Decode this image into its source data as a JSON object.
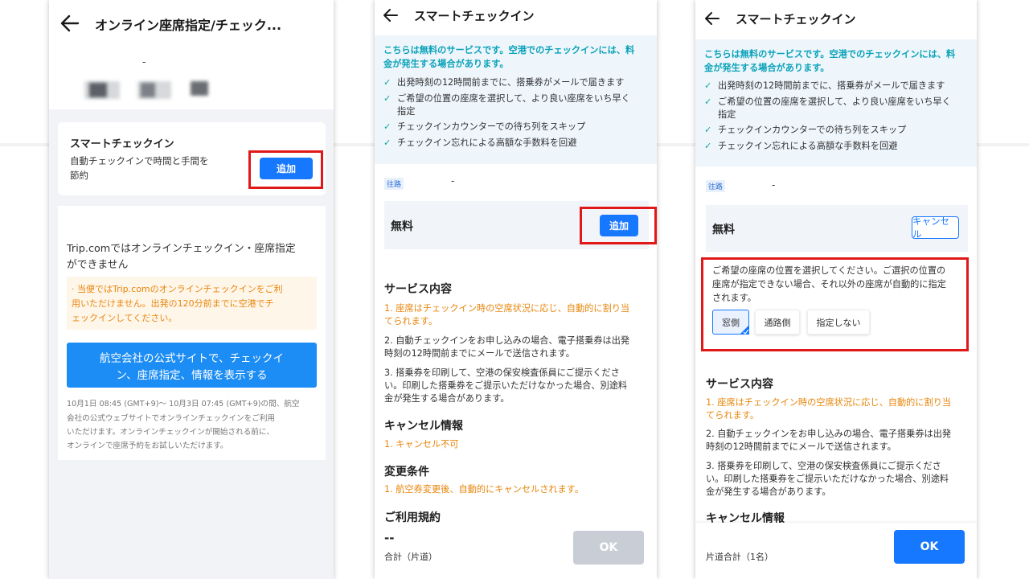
{
  "p1": {
    "title": "オンライン座席指定/チェック...",
    "dash": "-",
    "smart": {
      "title": "スマートチェックイン",
      "desc_line1": "自動チェックインで時間と手間を",
      "desc_line2": "節約",
      "add": "追加"
    },
    "notice_line1": "Trip.comではオンラインチェックイン・座席指定",
    "notice_line2": "ができません",
    "warn_line1": "· 当便ではTrip.comのオンラインチェックインをご利",
    "warn_line2": "用いただけません。出発の120分前までに空港でチ",
    "warn_line3": "ェックインしてください。",
    "airline_btn_line1": "航空会社の公式サイトで、チェックイ",
    "airline_btn_line2": "ン、座席指定、情報を表示する",
    "foot_line1": "10月1日 08:45 (GMT+9)〜 10月3日 07:45 (GMT+9)の間、航空",
    "foot_line2": "会社の公式ウェブサイトでオンラインチェックインをご利用",
    "foot_line3": "いただけます。オンラインチェックインが開始される前に、",
    "foot_line4": "オンラインで座席予約をお試しいただけます。"
  },
  "p2": {
    "title": "スマートチェックイン",
    "note_line1": "こちらは無料のサービスです。空港でのチェックインには、料",
    "note_line2": "金が発生する場合があります。",
    "checks": [
      "出発時刻の12時間前までに、搭乗券がメールで届きます",
      "ご希望の位置の座席を選択して、より良い座席をいち早く",
      "指定",
      "チェックインカウンターでの待ち列をスキップ",
      "チェックイン忘れによる高額な手数料を回避"
    ],
    "route_tag": "往路",
    "route_dash": "-",
    "free": "無料",
    "add": "追加",
    "service_title": "サービス内容",
    "s1_line1": "1. 座席はチェックイン時の空席状況に応じ、自動的に割り当",
    "s1_line2": "てられます。",
    "s2_line1": "2. 自動チェックインをお申し込みの場合、電子搭乗券は出発",
    "s2_line2": "時刻の12時間前までにメールで送信されます。",
    "s3_line1": "3. 搭乗券を印刷して、空港の保安検査係員にご提示くださ",
    "s3_line2": "い。印刷した搭乗券をご提示いただけなかった場合、別途料",
    "s3_line3": "金が発生する場合があります。",
    "cancel_title": "キャンセル情報",
    "cancel_item": "1. キャンセル不可",
    "change_title": "変更条件",
    "change_item": "1. 航空券変更後、自動的にキャンセルされます。",
    "terms_title": "ご利用規約",
    "price": "--",
    "total_label": "合計（片道）",
    "ok": "OK"
  },
  "p3": {
    "title": "スマートチェックイン",
    "note_line1": "こちらは無料のサービスです。空港でのチェックインには、料",
    "note_line2": "金が発生する場合があります。",
    "checks": [
      "出発時刻の12時間前までに、搭乗券がメールで届きます",
      "ご希望の位置の座席を選択して、より良い座席をいち早く",
      "指定",
      "チェックインカウンターでの待ち列をスキップ",
      "チェックイン忘れによる高額な手数料を回避"
    ],
    "route_tag": "往路",
    "route_dash": "-",
    "free": "無料",
    "cancel_btn": "キャンセル",
    "seat_line1": "ご希望の座席の位置を選択してください。ご選択の位置の",
    "seat_line2": "座席が指定できない場合、それ以外の座席が自動的に指定",
    "seat_line3": "されます。",
    "seat_options": [
      "窓側",
      "通路側",
      "指定しない"
    ],
    "service_title": "サービス内容",
    "s1_line1": "1. 座席はチェックイン時の空席状況に応じ、自動的に割り当",
    "s1_line2": "てられます。",
    "s2_line1": "2. 自動チェックインをお申し込みの場合、電子搭乗券は出発",
    "s2_line2": "時刻の12時間前までにメールで送信されます。",
    "s3_line1": "3. 搭乗券を印刷して、空港の保安検査係員にご提示くださ",
    "s3_line2": "い。印刷した搭乗券をご提示いただけなかった場合、別途料",
    "s3_line3": "金が発生する場合があります。",
    "cancel_title": "キャンセル情報",
    "total_label": "片道合計（1名）",
    "ok": "OK"
  },
  "colors": {
    "accent": "#1677ff",
    "highlight": "#e01818",
    "warning": "#e8860c",
    "note": "#0aa2b8"
  },
  "icons": {
    "back": "back-arrow-icon",
    "check": "check-icon"
  }
}
